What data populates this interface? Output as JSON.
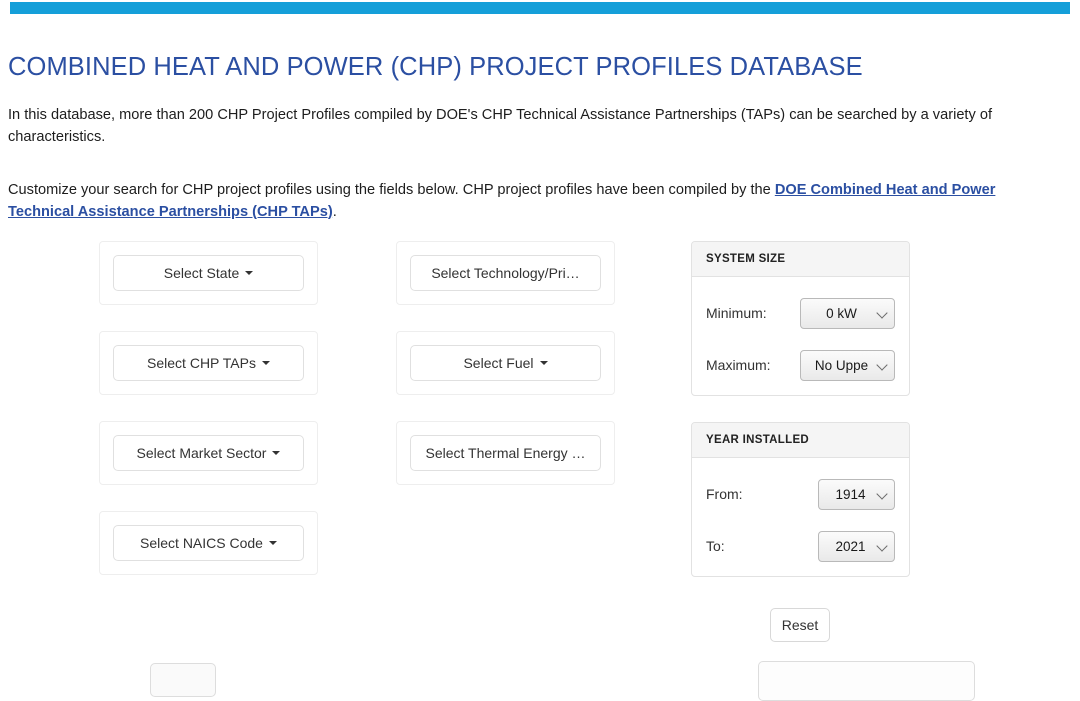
{
  "top_band": {
    "color": "#159fd9"
  },
  "header": {
    "title": "COMBINED HEAT AND POWER (CHP) PROJECT PROFILES DATABASE",
    "title_color": "#2b4fa2",
    "intro_paragraph": "In this database, more than 200 CHP Project Profiles compiled by DOE's CHP Technical Assistance Partnerships (TAPs) can be searched by a variety of characteristics.",
    "customize_paragraph_before": "Customize your search for CHP project profiles using the fields below. CHP project profiles have been compiled by the ",
    "customize_link_text": "DOE Combined Heat and Power Technical Assistance Partnerships (CHP TAPs)",
    "customize_paragraph_after": ".",
    "link_color": "#2b4fa2"
  },
  "filters": {
    "column1": [
      {
        "label": "Select State",
        "caret": "caret-down-icon"
      },
      {
        "label": "Select CHP TAPs",
        "caret": "caret-down-icon"
      },
      {
        "label": "Select Market Sector",
        "caret": "caret-down-icon"
      },
      {
        "label": "Select NAICS Code",
        "caret": "caret-down-icon"
      }
    ],
    "column2": [
      {
        "label": "Select Technology/Pri…",
        "caret": ""
      },
      {
        "label": "Select Fuel",
        "caret": "caret-down-icon"
      },
      {
        "label": "Select Thermal Energy …",
        "caret": ""
      }
    ]
  },
  "system_size": {
    "header": "SYSTEM SIZE",
    "rows": [
      {
        "label": "Minimum:",
        "value": "0 kW"
      },
      {
        "label": "Maximum:",
        "value": "No Uppe"
      }
    ]
  },
  "year_installed": {
    "header": "YEAR INSTALLED",
    "rows": [
      {
        "label": "From:",
        "value": "1914"
      },
      {
        "label": "To:",
        "value": "2021"
      }
    ]
  },
  "actions": {
    "reset_label": "Reset"
  }
}
